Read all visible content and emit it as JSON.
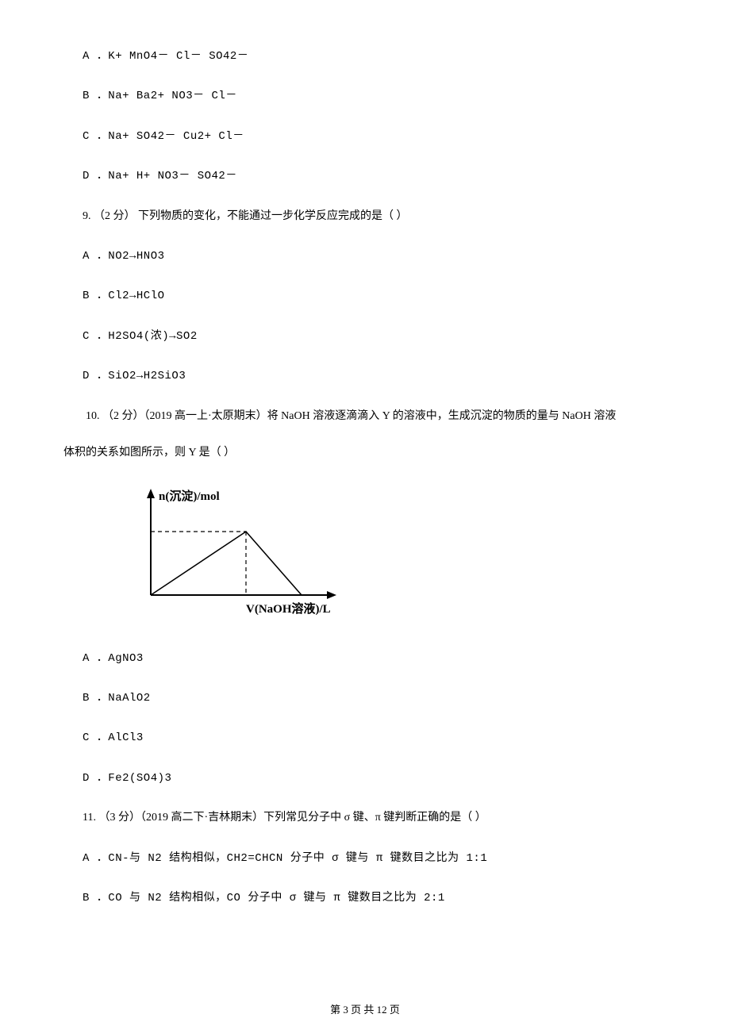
{
  "q8": {
    "optA": "A ．K+       MnO4－    Cl－     SO42－",
    "optB": "B ．Na+      Ba2+     NO3－      Cl－",
    "optC": "C ．Na+    SO42－      Cu2+     Cl－",
    "optD": "D ．Na+     H+        NO3－      SO42－"
  },
  "q9": {
    "stem": "9. （2 分） 下列物质的变化，不能通过一步化学反应完成的是（    ）",
    "optA": "A ．NO2→HNO3",
    "optB": "B ．Cl2→HClO",
    "optC": "C ．H2SO4(浓)→SO2",
    "optD": "D ．SiO2→H2SiO3"
  },
  "q10": {
    "stem_line1": "10. （2 分）（2019 高一上·太原期末）将 NaOH 溶液逐滴滴入 Y 的溶液中，生成沉淀的物质的量与 NaOH 溶液",
    "stem_line2": "体积的关系如图所示，则 Y 是（    ）",
    "optA": "A ．AgNO3",
    "optB": "B ．NaAlO2",
    "optC": "C ．AlCl3",
    "optD": "D ．Fe2(SO4)3"
  },
  "q11": {
    "stem": "11. （3 分）（2019 高二下·吉林期末）下列常见分子中 σ 键、π 键判断正确的是（    ）",
    "optA": "A ．CN-与 N2 结构相似，CH2=CHCN 分子中 σ 键与 π 键数目之比为 1:1",
    "optB": "B ．CO 与 N2 结构相似，CO 分子中 σ 键与 π 键数目之比为 2:1"
  },
  "chart_data": {
    "type": "line",
    "title": "",
    "xlabel": "V(NaOH溶液)/L",
    "ylabel": "n(沉淀)/mol",
    "series": [
      {
        "name": "precipitate",
        "points": [
          [
            0,
            0
          ],
          [
            1,
            1
          ],
          [
            1.6,
            0
          ]
        ]
      }
    ],
    "annotations": {
      "dashed_peak": [
        1,
        1
      ]
    },
    "xlim": [
      0,
      2.2
    ],
    "ylim": [
      0,
      1.3
    ]
  },
  "footer": "第 3 页 共 12 页"
}
